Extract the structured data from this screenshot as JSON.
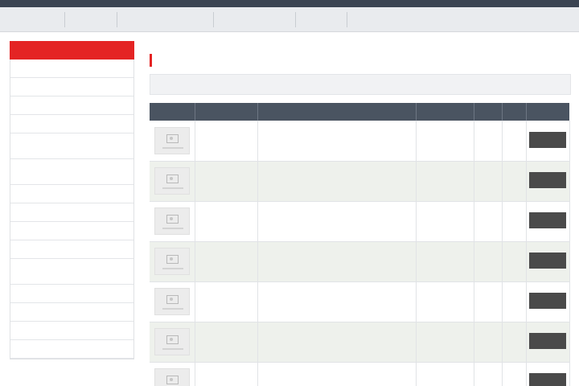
{
  "nav": {
    "items": [
      {
        "label": ""
      },
      {
        "label": ""
      },
      {
        "label": ""
      },
      {
        "label": ""
      },
      {
        "label": ""
      }
    ]
  },
  "sidebar": {
    "title": "",
    "items": [
      {
        "label": ""
      },
      {
        "label": ""
      },
      {
        "label": ""
      },
      {
        "label": ""
      },
      {
        "label": ""
      },
      {
        "label": ""
      },
      {
        "label": ""
      },
      {
        "label": ""
      },
      {
        "label": ""
      },
      {
        "label": ""
      },
      {
        "label": ""
      },
      {
        "label": ""
      },
      {
        "label": ""
      },
      {
        "label": ""
      },
      {
        "label": ""
      }
    ]
  },
  "breadcrumb": {
    "home": "",
    "separator": "",
    "current": ""
  },
  "page": {
    "title": ""
  },
  "sort": {
    "label": ""
  },
  "table": {
    "headers": {
      "photo": "",
      "code": "",
      "name": "",
      "manufacturer": "",
      "quantity": "",
      "price": "",
      "action": ""
    },
    "rows": [
      {
        "code": "",
        "name": "",
        "manufacturer": "",
        "quantity": "",
        "price": "",
        "button": ""
      },
      {
        "code": "",
        "name": "",
        "manufacturer": "",
        "quantity": "",
        "price": "",
        "button": ""
      },
      {
        "code": "",
        "name": "",
        "manufacturer": "",
        "quantity": "",
        "price": "",
        "button": ""
      },
      {
        "code": "",
        "name": "",
        "manufacturer": "",
        "quantity": "",
        "price": "",
        "button": ""
      },
      {
        "code": "",
        "name": "",
        "manufacturer": "",
        "quantity": "",
        "price": "",
        "button": ""
      },
      {
        "code": "",
        "name": "",
        "manufacturer": "",
        "quantity": "",
        "price": "",
        "button": ""
      },
      {
        "code": "",
        "name": "",
        "manufacturer": "",
        "quantity": "",
        "price": "",
        "button": ""
      }
    ]
  },
  "colors": {
    "accent": "#e42424",
    "nav_dark": "#3b4452",
    "table_header": "#4a5461",
    "button": "#4a4a4a",
    "row_alt": "#eef1ec"
  },
  "icons": {
    "thumbnail": "image-placeholder-icon"
  }
}
